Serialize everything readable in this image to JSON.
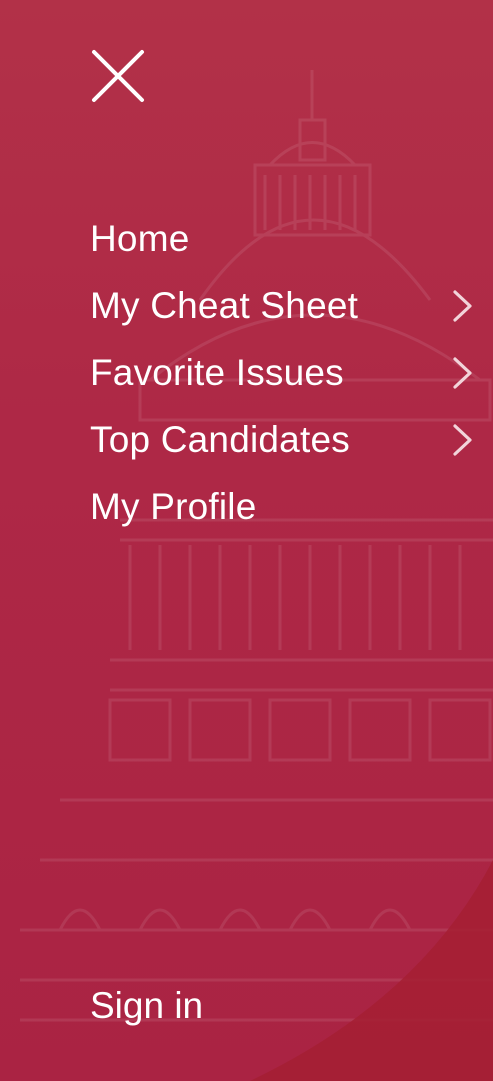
{
  "menu": {
    "close_icon": "close-icon",
    "items": [
      {
        "label": "Home",
        "has_submenu": false
      },
      {
        "label": "My Cheat Sheet",
        "has_submenu": true
      },
      {
        "label": "Favorite Issues",
        "has_submenu": true
      },
      {
        "label": "Top Candidates",
        "has_submenu": true
      },
      {
        "label": "My Profile",
        "has_submenu": false
      }
    ],
    "chevron_icon": "chevron-right-icon"
  },
  "footer": {
    "signin_label": "Sign in"
  },
  "colors": {
    "background": "#ae2846",
    "corner_accent": "#a51f33",
    "text": "#ffffff",
    "chevron": "#f2d4da"
  }
}
